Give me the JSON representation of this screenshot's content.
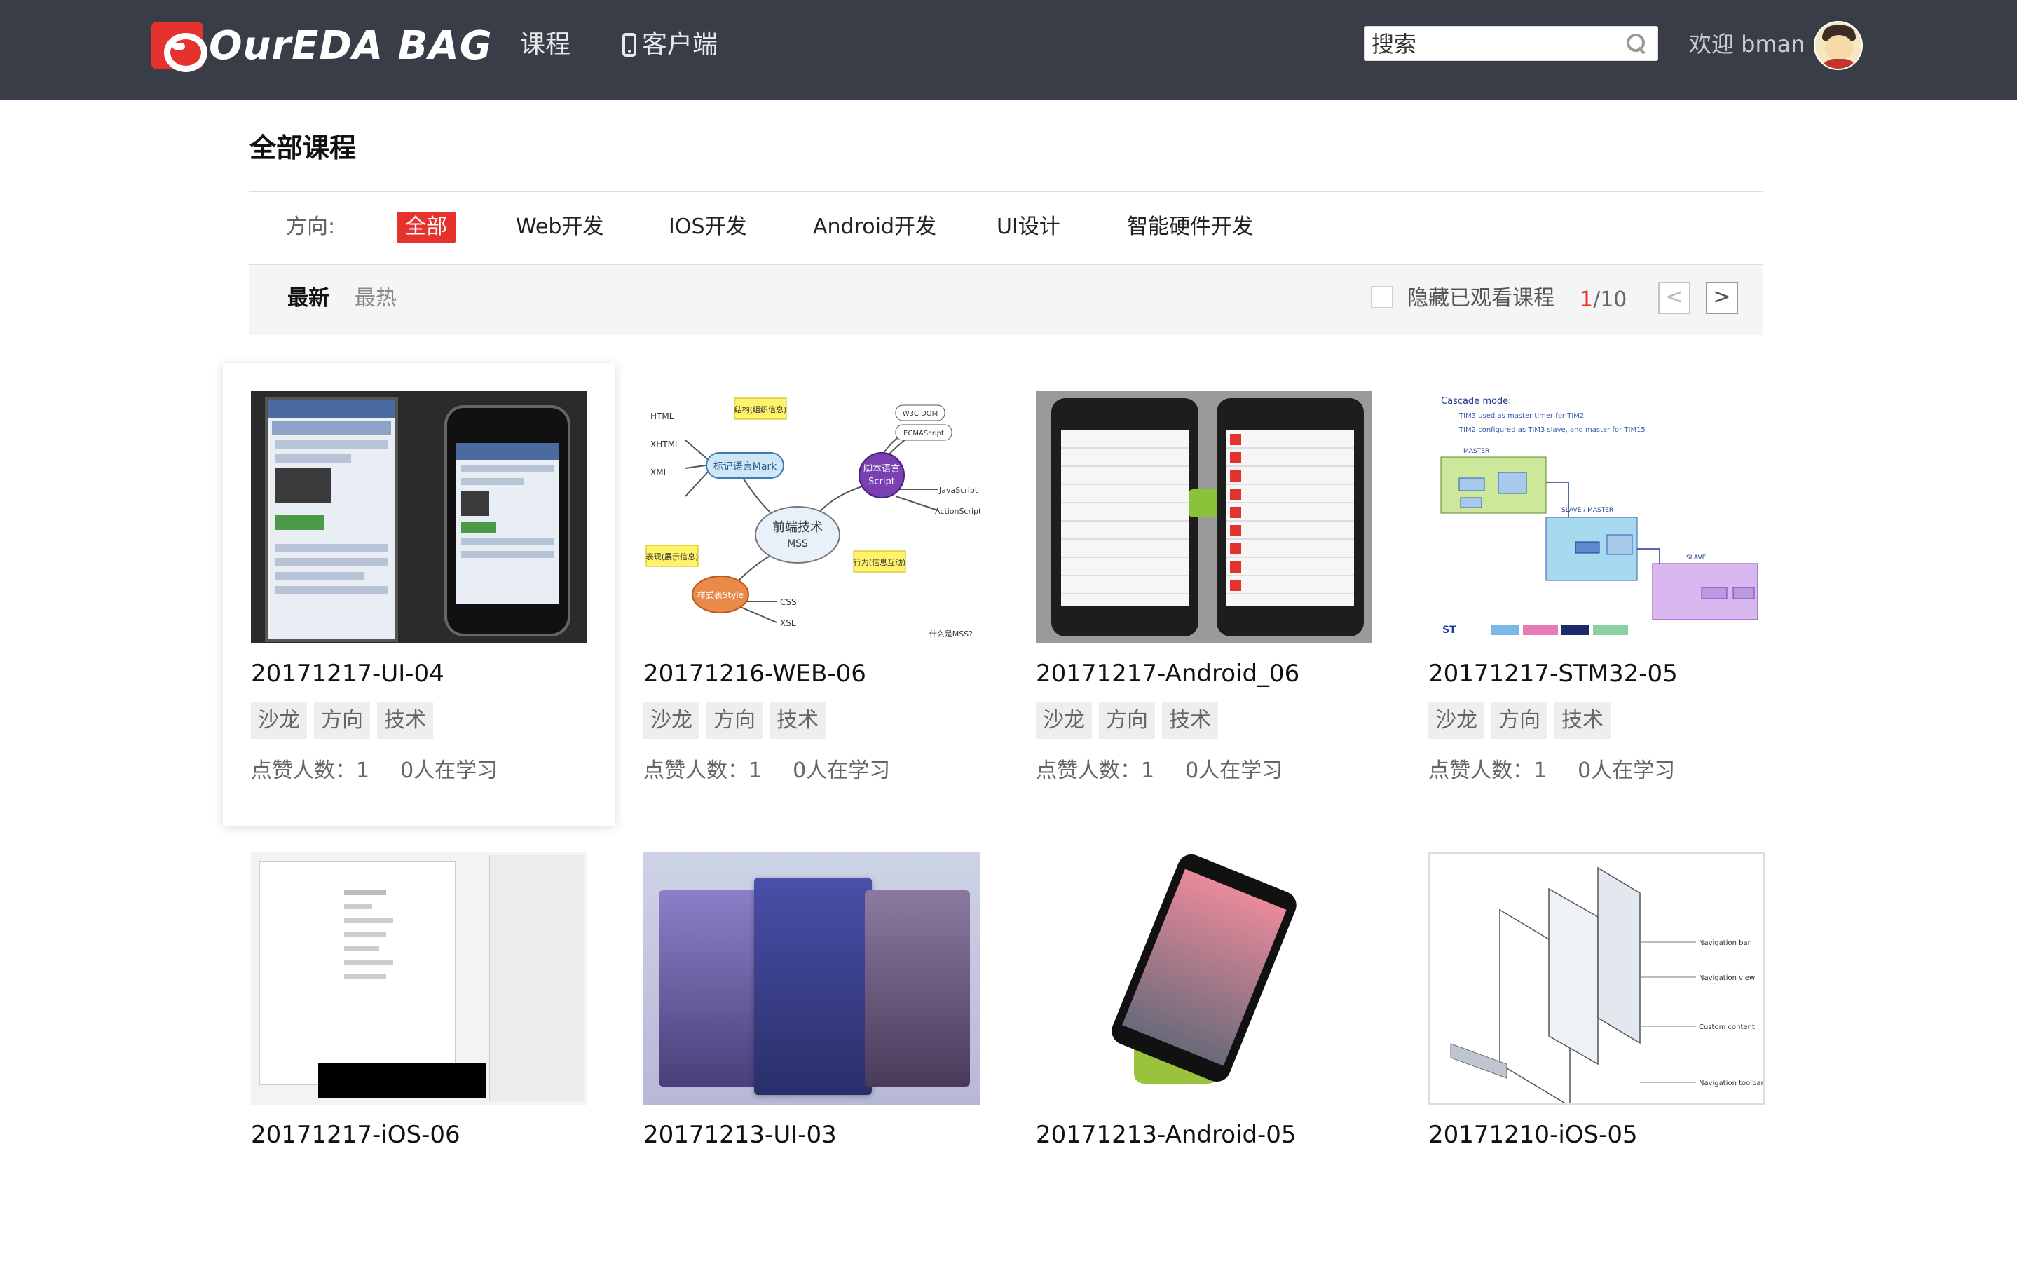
{
  "header": {
    "logo_text": "OurEDA BAG",
    "nav": [
      "课程",
      "客户端"
    ],
    "search_placeholder": "搜索",
    "welcome": "欢迎 bman"
  },
  "page": {
    "title": "全部课程"
  },
  "filter": {
    "label": "方向:",
    "items": [
      "全部",
      "Web开发",
      "IOS开发",
      "Android开发",
      "UI设计",
      "智能硬件开发"
    ],
    "active": "全部"
  },
  "sort": {
    "items": [
      "最新",
      "最热"
    ],
    "active": "最新",
    "hide_watched": "隐藏已观看课程",
    "page_current": "1",
    "page_total": "/10",
    "prev": "<",
    "next": ">"
  },
  "colors": {
    "accent": "#e5322d",
    "header_bg": "#383d48"
  },
  "courses": [
    {
      "title": "20171217-UI-04",
      "tags": [
        "沙龙",
        "方向",
        "技术"
      ],
      "likes": "点赞人数：1",
      "learning": "0人在学习"
    },
    {
      "title": "20171216-WEB-06",
      "tags": [
        "沙龙",
        "方向",
        "技术"
      ],
      "likes": "点赞人数：1",
      "learning": "0人在学习"
    },
    {
      "title": "20171217-Android_06",
      "tags": [
        "沙龙",
        "方向",
        "技术"
      ],
      "likes": "点赞人数：1",
      "learning": "0人在学习"
    },
    {
      "title": "20171217-STM32-05",
      "tags": [
        "沙龙",
        "方向",
        "技术"
      ],
      "likes": "点赞人数：1",
      "learning": "0人在学习"
    },
    {
      "title": "20171217-iOS-06"
    },
    {
      "title": "20171213-UI-03"
    },
    {
      "title": "20171213-Android-05"
    },
    {
      "title": "20171210-iOS-05"
    }
  ],
  "thumb_text": {
    "web06": {
      "center": "前端技术",
      "center2": "MSS",
      "markup": "标记语言Mark",
      "script": "脚本语言",
      "script2": "Script",
      "style": "样式表Style",
      "c1": "结构(组织信息)",
      "c2": "表现(展示信息)",
      "c3": "行为(信息互动)",
      "html": "HTML",
      "xhtml": "XHTML",
      "xml": "XML",
      "css": "CSS",
      "xsl": "XSL",
      "js": "JavaScript",
      "as": "ActionScript",
      "w3c": "W3C DOM",
      "ecma": "ECMAScript",
      "q": "什么是MSS?"
    },
    "stm": {
      "title": "Cascade mode:",
      "b1": "TIM3 used as master timer for TIM2",
      "b2": "TIM2 configured as TIM3 slave, and master for TIM15",
      "master": "MASTER",
      "slave": "SLAVE",
      "sm": "SLAVE / MASTER",
      "logo": "ST"
    },
    "ios05": {
      "a": "Navigation bar",
      "b": "Navigation view",
      "c": "Custom content",
      "d": "Navigation toolbar"
    }
  }
}
